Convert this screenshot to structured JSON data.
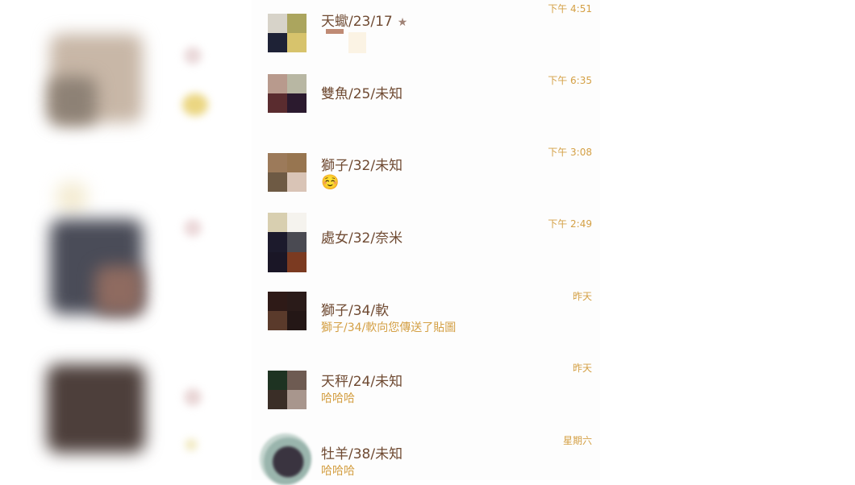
{
  "conversations": [
    {
      "name": "天蠍/23/17",
      "time": "下午 4:51",
      "message": "",
      "starred": true,
      "avatar_colors": [
        "#d7d3c9",
        "#aba55e",
        "#1e2236",
        "#d7c36c"
      ]
    },
    {
      "name": "雙魚/25/未知",
      "time": "下午 6:35",
      "message": "",
      "avatar_colors": [
        "#b89a8d",
        "#b8b7a3",
        "#5a2c2f",
        "#2b1a2e"
      ]
    },
    {
      "name": "獅子/32/未知",
      "time": "下午 3:08",
      "message": "☺️",
      "avatar_colors": [
        "#9c7a5a",
        "#977550",
        "#6e5a44",
        "#d9c4b6"
      ]
    },
    {
      "name": "處女/32/奈米",
      "time": "下午 2:49",
      "message": "",
      "avatar_colors": [
        "#d8cfb0",
        "#f5f3ee",
        "#1c1a2c",
        "#4a4a52",
        "#1a1626",
        "#7b3a21"
      ]
    },
    {
      "name": "獅子/34/軟",
      "time": "昨天",
      "message": "獅子/34/軟向您傳送了貼圖",
      "avatar_colors": [
        "#2e1a17",
        "#2a1b19",
        "#5a3a2b",
        "#241716"
      ]
    },
    {
      "name": "天秤/24/未知",
      "time": "昨天",
      "message": "哈哈哈",
      "avatar_colors": [
        "#1e3322",
        "#6e5b52",
        "#3a2e27",
        "#a8968d"
      ]
    },
    {
      "name": "牡羊/38/未知",
      "time": "星期六",
      "message": "哈哈哈",
      "avatar_colors": [
        "#c6d6d0",
        "#3a3440"
      ]
    }
  ],
  "theme": {
    "name_color": "#6f4a32",
    "accent": "#d4a045"
  }
}
